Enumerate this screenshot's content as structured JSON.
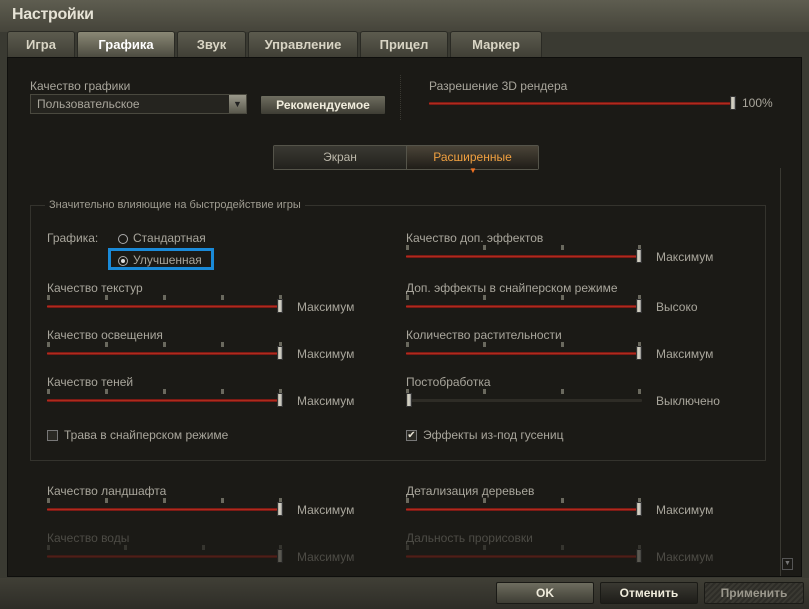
{
  "title": "Настройки",
  "tabs": [
    "Игра",
    "Графика",
    "Звук",
    "Управление",
    "Прицел",
    "Маркер"
  ],
  "active_tab": 1,
  "quality": {
    "label": "Качество графики",
    "value": "Пользовательское",
    "recommended_label": "Рекомендуемое"
  },
  "render": {
    "label": "Разрешение 3D рендера",
    "value": "100%",
    "fraction": 1.0
  },
  "segments": [
    "Экран",
    "Расширенные"
  ],
  "group": {
    "legend": "Значительно влияющие на быстродействие игры",
    "graphics_label": "Графика:",
    "radio": [
      "Стандартная",
      "Улучшенная"
    ],
    "radio_selected": 1
  },
  "sliders": [
    {
      "label": "Качество текстур",
      "value": "Максимум",
      "levels": 5,
      "fraction": 1
    },
    {
      "label": "Качество освещения",
      "value": "Максимум",
      "levels": 5,
      "fraction": 1
    },
    {
      "label": "Качество теней",
      "value": "Максимум",
      "levels": 5,
      "fraction": 1
    },
    {
      "label": "Качество доп. эффектов",
      "value": "Максимум",
      "levels": 4,
      "fraction": 1
    },
    {
      "label": "Доп. эффекты в снайперском режиме",
      "value": "Высоко",
      "levels": 4,
      "fraction": 1
    },
    {
      "label": "Количество растительности",
      "value": "Максимум",
      "levels": 4,
      "fraction": 1
    },
    {
      "label": "Постобработка",
      "value": "Выключено",
      "levels": 4,
      "fraction": 0
    },
    {
      "label": "Качество ландшафта",
      "value": "Максимум",
      "levels": 5,
      "fraction": 1
    },
    {
      "label": "Детализация деревьев",
      "value": "Максимум",
      "levels": 4,
      "fraction": 1
    },
    {
      "label": "Качество воды",
      "value": "Максимум",
      "levels": 4,
      "fraction": 1
    },
    {
      "label": "Дальность прорисовки",
      "value": "Максимум",
      "levels": 4,
      "fraction": 1
    }
  ],
  "checkboxes": [
    {
      "label": "Трава в снайперском режиме",
      "checked": false
    },
    {
      "label": "Эффекты из-под гусениц",
      "checked": true
    }
  ],
  "buttons": {
    "ok": "OK",
    "cancel": "Отменить",
    "apply": "Применить"
  }
}
